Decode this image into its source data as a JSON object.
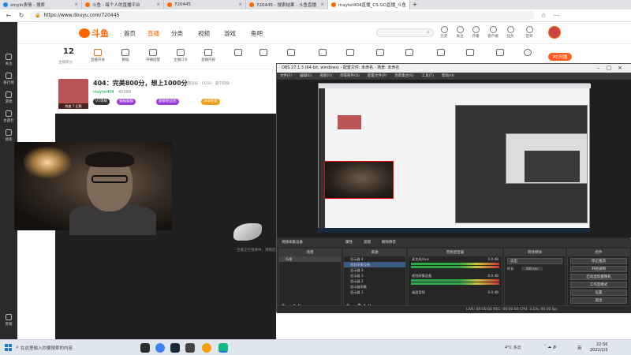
{
  "browser": {
    "tabs": [
      {
        "title": "xinyin表情 - 搜索"
      },
      {
        "title": "斗鱼 - 每个人的直播平台"
      },
      {
        "title": "720445"
      },
      {
        "title": "720445 - 搜索结果 - 斗鱼直播"
      },
      {
        "title": "maytel404直播_CS:GO直播_斗鱼"
      }
    ],
    "url": "https://www.douyu.com/720445"
  },
  "douyu": {
    "logo_text": "斗鱼",
    "nav": [
      "首页",
      "直播",
      "分类",
      "视频",
      "游戏",
      "鱼吧"
    ],
    "active_nav": "直播",
    "sidebar": [
      "关注",
      "排行榜",
      "游戏",
      "主题栏",
      "搜索",
      "客服"
    ],
    "header_icons": [
      "历史",
      "关注",
      "开播",
      "客户端",
      "任务",
      "签到"
    ],
    "toolbar": {
      "level": "12",
      "level_label": "主播积分",
      "items": [
        "直播开关",
        "数据",
        "开播提醒",
        "主播口令",
        "直播内容"
      ],
      "pc_button": "PC开播"
    },
    "room": {
      "title": "404：完美800分，想上1000分",
      "meta": "举报 · 网游竞技 · CSGO · 最学得快",
      "streamer": "maytel404",
      "followers": "45398",
      "badges": [
        "V5等级",
        "猫猫猫猫",
        "超级粉丝团",
        "368荣誉"
      ],
      "avatar_caption": "热度 7 企鹅"
    },
    "offline_text": "主播正在独休中，请稍后刷新..."
  },
  "obs": {
    "title": "OBS 27.1.3 (64-bit, windows) - 配置文件: 未命名 - 场景: 未命名",
    "menu": [
      "文件(F)",
      "编辑(E)",
      "视图(V)",
      "停靠部件(D)",
      "配置文件(P)",
      "场景集合(S)",
      "工具(T)",
      "帮助(H)"
    ],
    "toolbar_labels": [
      "视频采集设备",
      "属性",
      "滤镜",
      "解除静音"
    ],
    "scenes_header": "场景",
    "scenes": [
      "场景"
    ],
    "sources_header": "来源",
    "sources": [
      "显示器 4",
      "视频采集设备",
      "显示器 3",
      "显示器 3",
      "显示器 2",
      "显示器采集",
      "显示器 1"
    ],
    "mixer_header": "音频混音器",
    "mixer": [
      {
        "name": "麦克风/Aux",
        "db": "0.0 dB"
      },
      {
        "name": "视频采集设备",
        "db": "0.0 dB"
      },
      {
        "name": "桌面音频",
        "db": "0.0 dB"
      }
    ],
    "transitions_header": "转场特效",
    "transition": "淡出",
    "duration_label": "时长",
    "duration_value": "300 ms",
    "controls_header": "控件",
    "controls": [
      "停止推流",
      "开始录制",
      "启动虚拟摄像机",
      "工作室模式",
      "设置",
      "退出"
    ],
    "status": "LIVE: 00:00:00   REC: 00:00:00   CPU: 3.1%, 60.00 fps"
  },
  "taskbar": {
    "search": "在这里输入你要搜索的内容",
    "weather": "4°C 多云",
    "ime": "英",
    "time": "22:56",
    "date": "2022/2/3"
  },
  "colors": {
    "douyu_orange": "#ff5d23",
    "obs_dark": "#2b2b2b",
    "purple_badge": "#9c3ddb"
  }
}
